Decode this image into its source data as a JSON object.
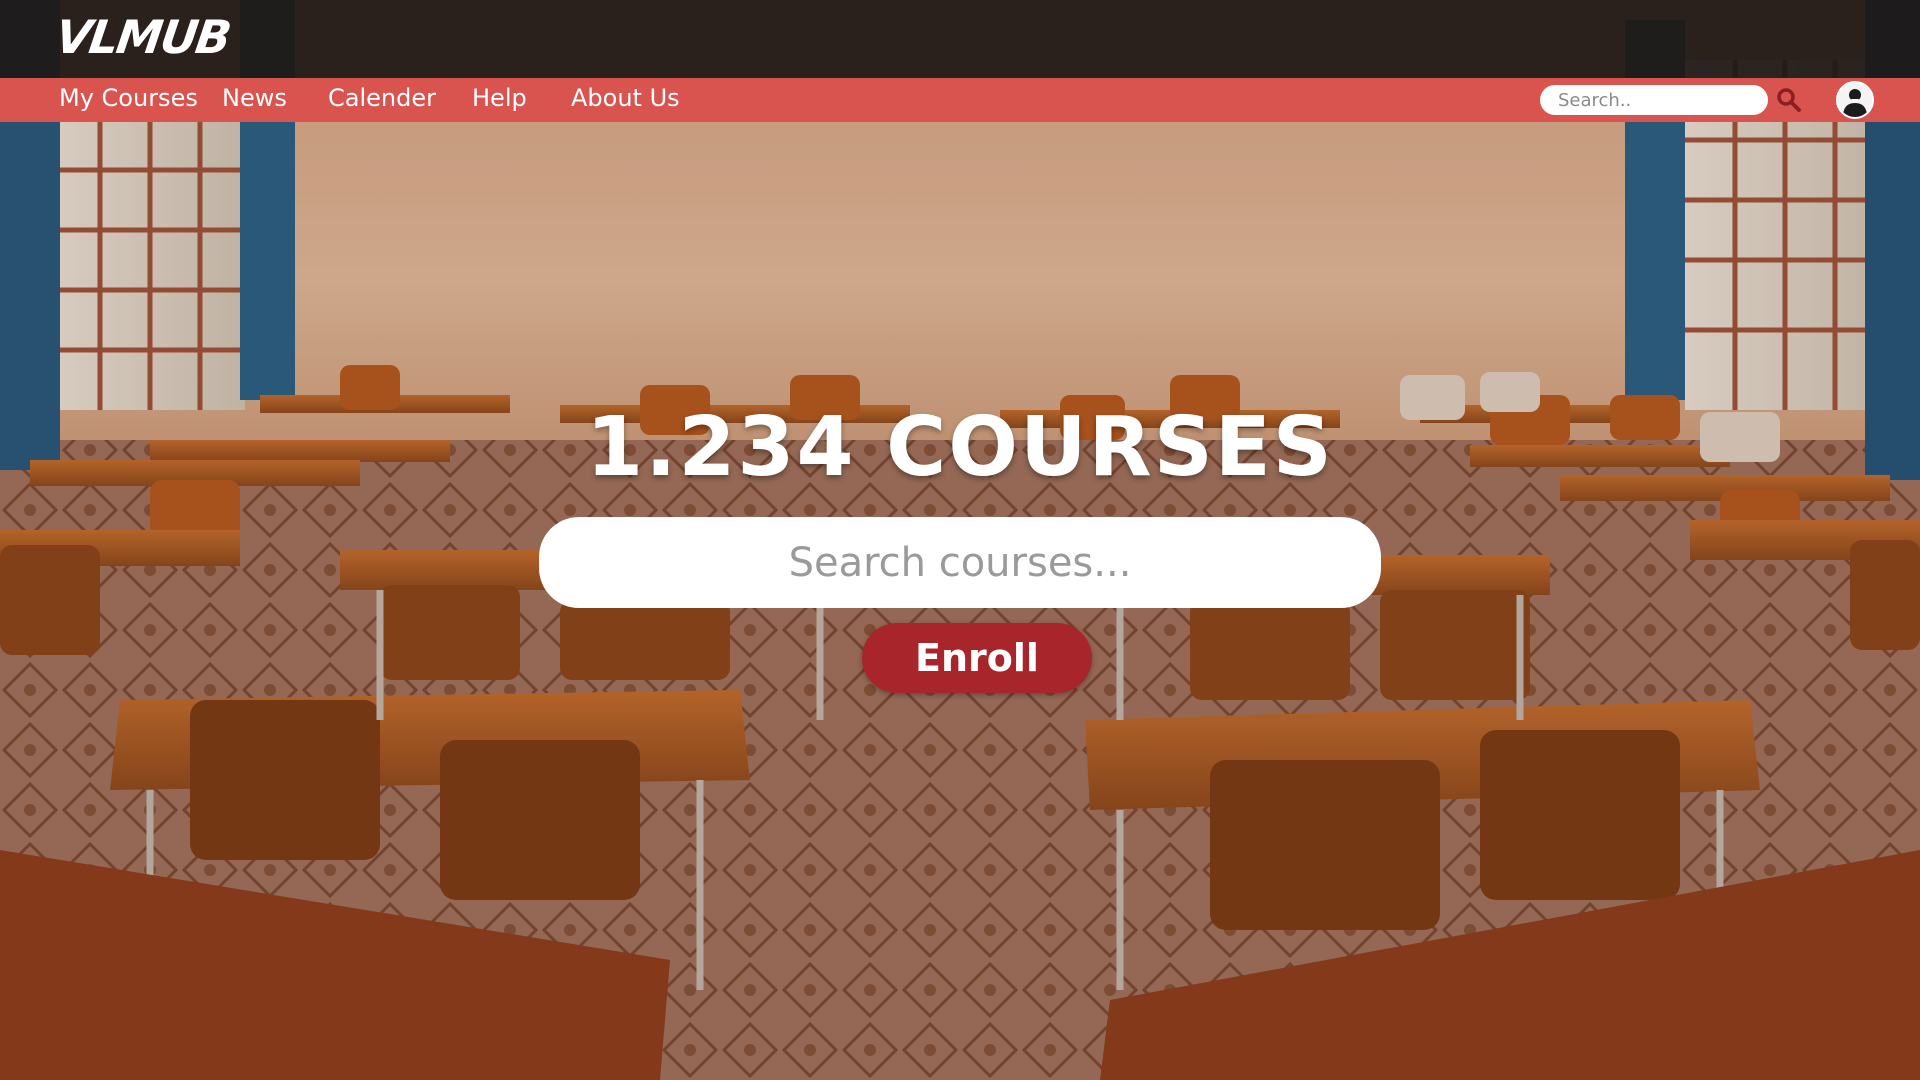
{
  "brand": {
    "logo_text": "VLMUB"
  },
  "nav": {
    "items": [
      {
        "label": "My Courses"
      },
      {
        "label": "News"
      },
      {
        "label": "Calender"
      },
      {
        "label": "Help"
      },
      {
        "label": "About Us"
      }
    ],
    "search_placeholder": "Search.."
  },
  "hero": {
    "title": "1.234 COURSES",
    "search_placeholder": "Search courses...",
    "enroll_label": "Enroll"
  },
  "icons": {
    "search": "search-icon",
    "avatar": "user-avatar-icon"
  },
  "colors": {
    "navbar": "#d9534f",
    "topbar": "#1e1816",
    "enroll_button": "#a8262b"
  }
}
